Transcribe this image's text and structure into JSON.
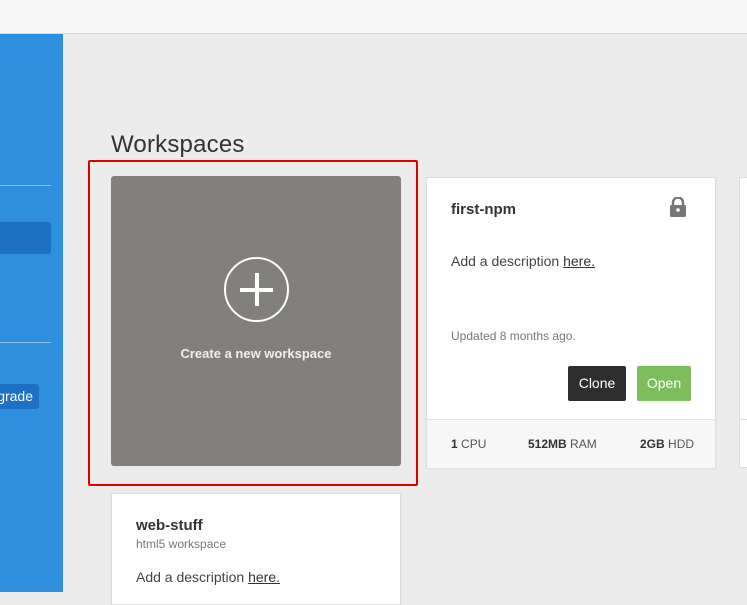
{
  "sidebar": {
    "upgrade_label": "Upgrade"
  },
  "main": {
    "title": "Workspaces",
    "create_card": {
      "label": "Create a new workspace"
    },
    "workspaces": [
      {
        "name": "first-npm",
        "description_prefix": "Add a description ",
        "description_link": "here.",
        "updated": "Updated 8 months ago.",
        "clone_label": "Clone",
        "open_label": "Open",
        "private": true,
        "specs": {
          "cpu_value": "1",
          "cpu_unit": "CPU",
          "ram_value": "512MB",
          "ram_unit": "RAM",
          "hdd_value": "2GB",
          "hdd_unit": "HDD"
        }
      },
      {
        "name": "web-stuff",
        "subtitle": "html5 workspace",
        "description_prefix": "Add a description ",
        "description_link": "here."
      }
    ]
  },
  "colors": {
    "sidebar": "#2f8fdf",
    "sidebar_active": "#1c71c4",
    "create_card": "#82807d",
    "clone_button": "#2e2e2e",
    "open_button": "#7dbd5b",
    "highlight": "#e00000"
  },
  "icons": {
    "lock": "lock-icon",
    "plus": "plus-circle-icon"
  }
}
